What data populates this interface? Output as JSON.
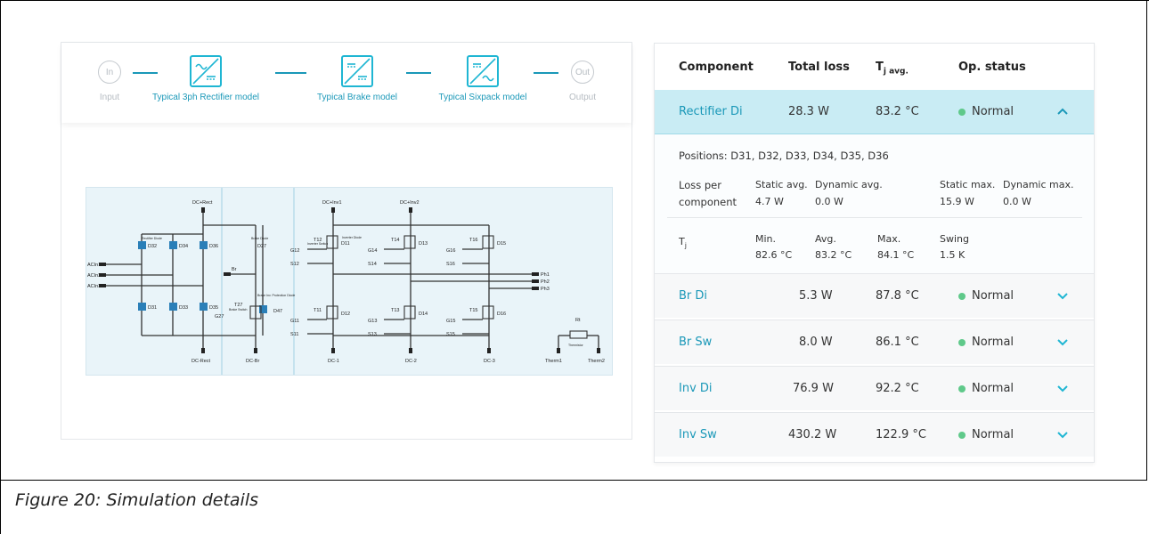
{
  "pipeline": {
    "input_label": "Input",
    "input_symbol": "In",
    "output_label": "Output",
    "output_symbol": "Out",
    "models": [
      {
        "label": "Typical 3ph Rectifier model"
      },
      {
        "label": "Typical Brake model"
      },
      {
        "label": "Typical Sixpack model"
      }
    ]
  },
  "schematic": {
    "labels": {
      "dc_rect_top": "DC+Rect",
      "dc_inv1": "DC+Inv1",
      "dc_inv2": "DC+Inv2",
      "acin1": "ACIn1",
      "acin2": "ACIn2",
      "acin3": "ACIn3",
      "d32": "D32",
      "d34": "D34",
      "d36": "D36",
      "d31": "D31",
      "d33": "D33",
      "d35": "D35",
      "d27": "D27",
      "d47": "D47",
      "t27": "T27",
      "g27": "G27",
      "br": "Br",
      "t12": "T12",
      "d11": "D11",
      "g12": "G12",
      "s12": "S12",
      "t14": "T14",
      "d13": "D13",
      "g14": "G14",
      "s14": "S14",
      "t16": "T16",
      "d15": "D15",
      "g16": "G16",
      "s16": "S16",
      "t11": "T11",
      "d12": "D12",
      "g11": "G11",
      "s11": "S11",
      "t13": "T13",
      "d14": "D14",
      "g13": "G13",
      "s13": "S13",
      "t15": "T15",
      "d16": "D16",
      "g15": "G15",
      "s15": "S15",
      "ph1": "Ph1",
      "ph2": "Ph2",
      "ph3": "Ph3",
      "rt": "Rt",
      "dc_rect_bot": "DC-Rect",
      "dc_br": "DC-Br",
      "dc_1": "DC-1",
      "dc_2": "DC-2",
      "dc_3": "DC-3",
      "therm1": "Therm1",
      "therm2": "Therm2",
      "rectifier_diode": "Rectifier Diode",
      "brake_diode": "Brake Diode",
      "inverter_diode": "Inverter Diode",
      "inverter_switch": "Inverter Switch",
      "brake_switch": "Brake Switch",
      "brake_protection": "Brake Inv. Protection Diode",
      "thermistor": "Thermistor"
    }
  },
  "table": {
    "headers": {
      "component": "Component",
      "total_loss": "Total loss",
      "tj_main": "T",
      "tj_sub": "j avg.",
      "status": "Op. status"
    },
    "rows": [
      {
        "name": "Rectifier Di",
        "loss": "28.3 W",
        "temp": "83.2 °C",
        "status": "Normal",
        "expanded": true
      },
      {
        "name": "Br Di",
        "loss": "5.3 W",
        "temp": "87.8 °C",
        "status": "Normal",
        "expanded": false
      },
      {
        "name": "Br Sw",
        "loss": "8.0 W",
        "temp": "86.1 °C",
        "status": "Normal",
        "expanded": false
      },
      {
        "name": "Inv Di",
        "loss": "76.9 W",
        "temp": "92.2 °C",
        "status": "Normal",
        "expanded": false
      },
      {
        "name": "Inv Sw",
        "loss": "430.2 W",
        "temp": "122.9 °C",
        "status": "Normal",
        "expanded": false
      }
    ],
    "details": {
      "positions": "Positions: D31, D32, D33, D34, D35, D36",
      "loss_per": "Loss per",
      "component": "component",
      "static_avg_label": "Static avg.",
      "static_avg": "4.7 W",
      "dynamic_avg_label": "Dynamic avg.",
      "dynamic_avg": "0.0 W",
      "static_max_label": "Static max.",
      "static_max": "15.9 W",
      "dynamic_max_label": "Dynamic max.",
      "dynamic_max": "0.0 W",
      "tj_label": "T",
      "tj_sub": "j",
      "min_label": "Min.",
      "min": "82.6 °C",
      "avg_label": "Avg.",
      "avg": "83.2 °C",
      "max_label": "Max.",
      "max": "84.1 °C",
      "swing_label": "Swing",
      "swing": "1.5 K"
    }
  },
  "colors": {
    "accent": "#1fb6d3",
    "status_ok": "#5fc98a",
    "active_row": "#c9ecf4"
  },
  "caption": "Figure 20: Simulation details"
}
